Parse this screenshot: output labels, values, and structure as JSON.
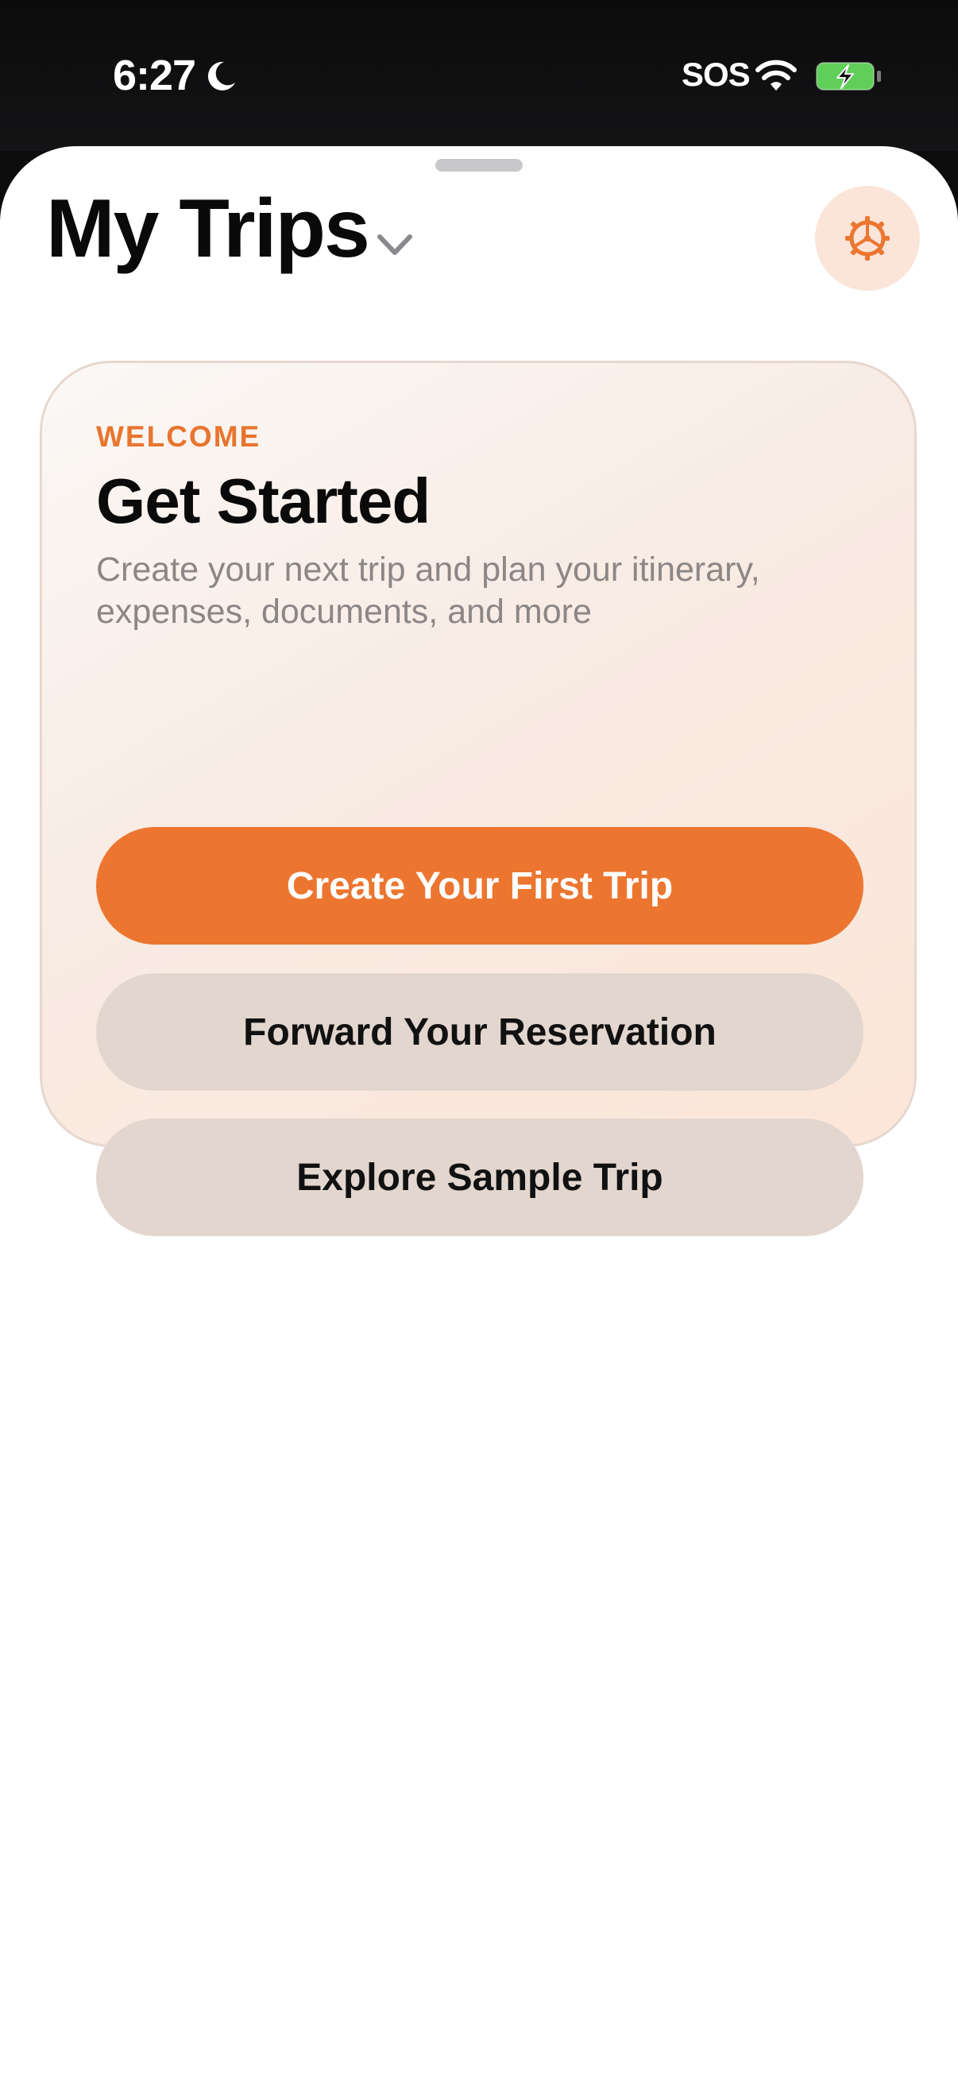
{
  "status_bar": {
    "time": "6:27",
    "carrier_status": "SOS",
    "icons": [
      "moon-icon",
      "wifi-icon",
      "battery-charging-icon"
    ]
  },
  "header": {
    "title": "My Trips",
    "title_menu_icon": "chevron-down-icon",
    "settings_icon": "gear-icon"
  },
  "welcome_card": {
    "eyebrow": "WELCOME",
    "title": "Get Started",
    "description": "Create your next trip and plan your itinerary, expenses, documents, and more",
    "primary_button": "Create Your First Trip",
    "forward_button": "Forward Your Reservation",
    "sample_button": "Explore Sample Trip"
  },
  "colors": {
    "accent": "#ec7630",
    "secondary_button": "#e2d6ce",
    "description_text": "#8c8685",
    "battery_fill": "#5fcf5a"
  }
}
